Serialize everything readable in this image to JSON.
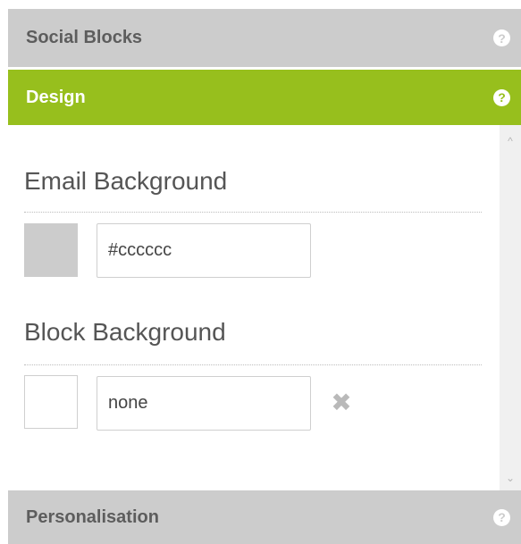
{
  "headers": {
    "social_blocks": "Social Blocks",
    "design": "Design",
    "personalisation": "Personalisation"
  },
  "help_glyph": "?",
  "design": {
    "email_background": {
      "label": "Email Background",
      "value": "#cccccc",
      "swatch_color": "#cccccc"
    },
    "block_background": {
      "label": "Block Background",
      "value": "none",
      "swatch_color": "#ffffff",
      "clear_glyph": "✖"
    }
  },
  "scroll": {
    "up_glyph": "^",
    "down_glyph": "⌄"
  },
  "colors": {
    "accent": "#97bf1d",
    "header_gray": "#cccccc",
    "header_text": "#5d5d5d"
  }
}
